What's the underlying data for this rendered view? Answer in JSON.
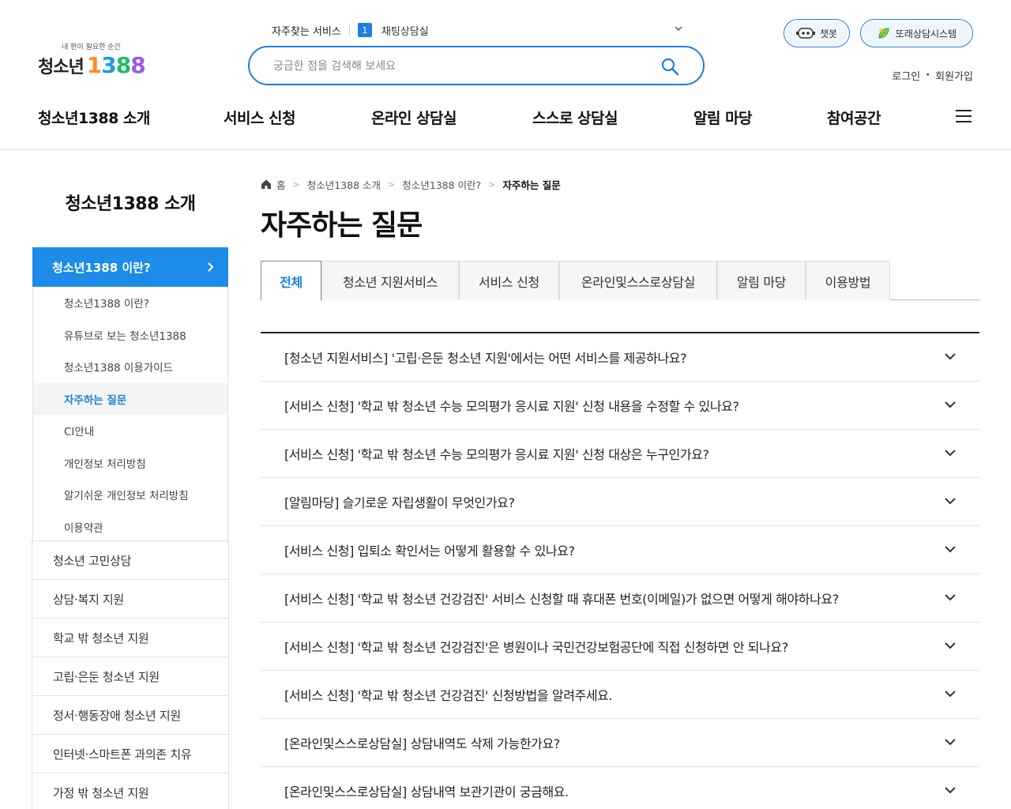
{
  "header": {
    "logo": {
      "tagline": "내 편이 필요한 순간",
      "name": "청소년",
      "number": [
        "1",
        "3",
        "8",
        "8"
      ]
    },
    "search_bar": {
      "faq_label": "자주찾는 서비스",
      "rank": "1",
      "rank_text": "채팅상담실",
      "placeholder": "궁금한 점을 검색해 보세요"
    },
    "chatbot_label": "챗봇",
    "peer_label": "또래상담시스템",
    "login": "로그인",
    "join": "회원가입",
    "gnb": [
      "청소년1388 소개",
      "서비스 신청",
      "온라인 상담실",
      "스스로 상담실",
      "알림 마당",
      "참여공간"
    ]
  },
  "sidebar": {
    "title": "청소년1388 소개",
    "active": "청소년1388 이란?",
    "sub_items": [
      "청소년1388 이란?",
      "유튜브로 보는 청소년1388",
      "청소년1388 이용가이드",
      "자주하는 질문",
      "CI안내",
      "개인정보 처리방침",
      "알기쉬운 개인정보 처리방침",
      "이용약관"
    ],
    "active_sub_index": 3,
    "main_items": [
      "청소년 고민상담",
      "상담·복지 지원",
      "학교 밖 청소년 지원",
      "고립·은둔 청소년 지원",
      "정서·행동장애 청소년 지원",
      "인터넷·스마트폰 과의존 치유",
      "가정 밖 청소년 지원"
    ]
  },
  "content": {
    "breadcrumb": [
      "홈",
      "청소년1388 소개",
      "청소년1388 이란?",
      "자주하는 질문"
    ],
    "title": "자주하는 질문",
    "tabs": [
      "전체",
      "청소년 지원서비스",
      "서비스 신청",
      "온라인및스스로상담실",
      "알림 마당",
      "이용방법"
    ],
    "active_tab_index": 0,
    "faqs": [
      "[청소년 지원서비스] '고립·은둔 청소년 지원'에서는 어떤 서비스를 제공하나요?",
      "[서비스 신청] '학교 밖 청소년 수능 모의평가 응시료 지원' 신청 내용을 수정할 수 있나요?",
      "[서비스 신청] '학교 밖 청소년 수능 모의평가 응시료 지원' 신청 대상은 누구인가요?",
      "[알림마당] 슬기로운 자립생활이 무엇인가요?",
      "[서비스 신청] 입퇴소 확인서는 어떻게 활용할 수 있나요?",
      "[서비스 신청] '학교 밖 청소년 건강검진' 서비스 신청할 때 휴대폰 번호(이메일)가 없으면 어떻게 해야하나요?",
      "[서비스 신청] '학교 밖 청소년 건강검진'은 병원이나 국민건강보험공단에 직접 신청하면 안 되나요?",
      "[서비스 신청] '학교 밖 청소년 건강검진' 신청방법을 알려주세요.",
      "[온라인및스스로상담실] 상담내역도 삭제 가능한가요?",
      "[온라인및스스로상담실] 상담내역 보관기관이 궁금해요."
    ]
  },
  "colors": {
    "accent": "#1d7fe0",
    "sidebar_active": "#1d8be8"
  }
}
